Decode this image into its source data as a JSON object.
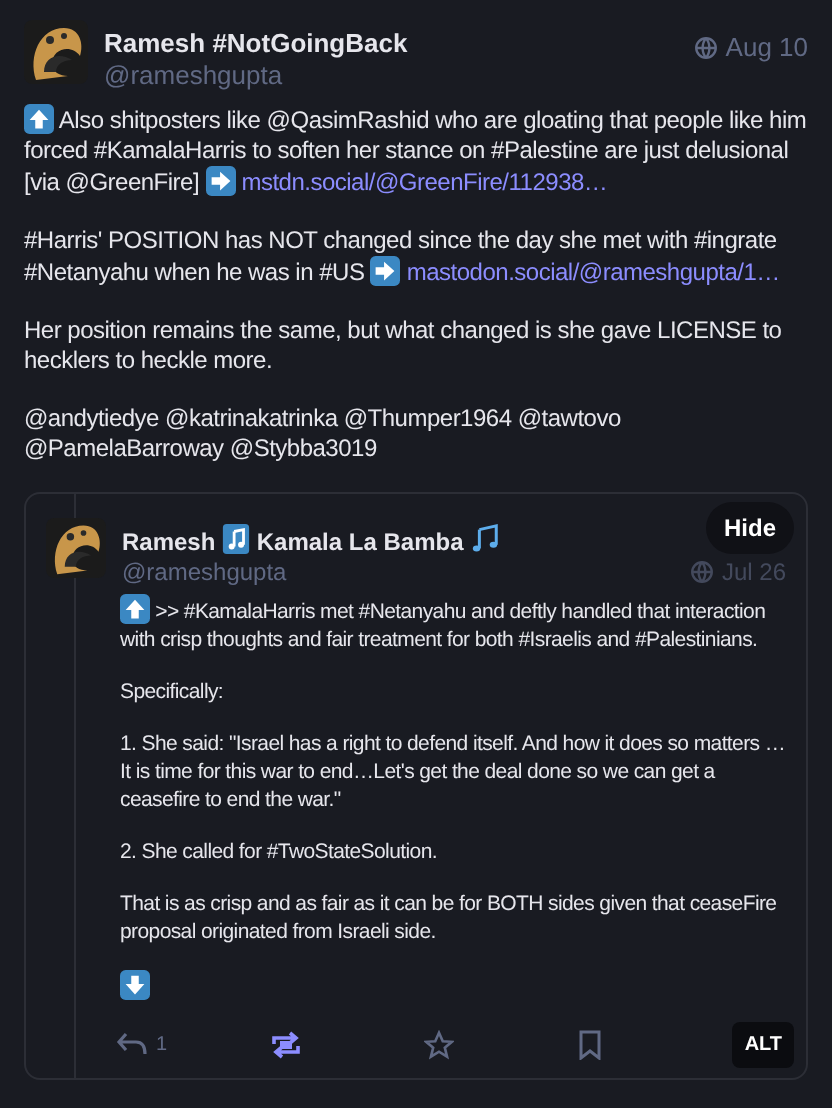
{
  "post": {
    "author": "Ramesh #NotGoingBack",
    "handle": "@rameshgupta",
    "date": "Aug 10",
    "paragraphs": [
      [
        {
          "kind": "arrow_up"
        },
        {
          "kind": "text",
          "text": " Also shitposters like @QasimRashid who are gloating that people like him forced #KamalaHarris to soften her stance on #Palestine are just delusional [via @GreenFire] "
        },
        {
          "kind": "arrow_right"
        },
        {
          "kind": "link",
          "text": " mstdn.social/@GreenFire/112938…"
        }
      ],
      [
        {
          "kind": "text",
          "text": "#Harris' POSITION has NOT changed since the day she met with #ingrate #Netanyahu when he was in #US "
        },
        {
          "kind": "arrow_right"
        },
        {
          "kind": "link",
          "text": " mastodon.social/@rameshgupta/1…"
        }
      ],
      [
        {
          "kind": "text",
          "text": "Her position remains the same, but what changed is she gave LICENSE to hecklers to heckle more."
        }
      ],
      [
        {
          "kind": "text",
          "text": "@andytiedye @katrinakatrinka @Thumper1964 @tawtovo @PamelaBarroway @Stybba3019"
        }
      ]
    ]
  },
  "quote": {
    "hide_label": "Hide",
    "author": [
      {
        "kind": "text",
        "text": "Ramesh "
      },
      {
        "kind": "note"
      },
      {
        "kind": "text",
        "text": " Kamala La Bamba "
      },
      {
        "kind": "notes"
      }
    ],
    "handle": "@rameshgupta",
    "date": "Jul 26",
    "paragraphs": [
      [
        {
          "kind": "arrow_up"
        },
        {
          "kind": "text",
          "text": " >> #KamalaHarris met #Netanyahu and deftly handled that interaction with crisp thoughts and fair treatment for both #Israelis and #Palestinians."
        }
      ],
      [
        {
          "kind": "text",
          "text": "Specifically:"
        }
      ],
      [
        {
          "kind": "text",
          "text": "1. She said: \"Israel has a right to defend itself. And how it does so matters … It is time for this war to end…Let's get the deal done so we can get a ceasefire to end the war.\""
        }
      ],
      [
        {
          "kind": "text",
          "text": "2. She called for #TwoStateSolution."
        }
      ],
      [
        {
          "kind": "text",
          "text": "That is as crisp and as fair as it can be for BOTH sides given that ceaseFire proposal originated from Israeli side."
        }
      ],
      [
        {
          "kind": "arrow_down"
        }
      ]
    ],
    "actions": {
      "reply_count": "1",
      "boosted": true,
      "favourited": false,
      "bookmarked": false
    },
    "alt_label": "ALT"
  }
}
